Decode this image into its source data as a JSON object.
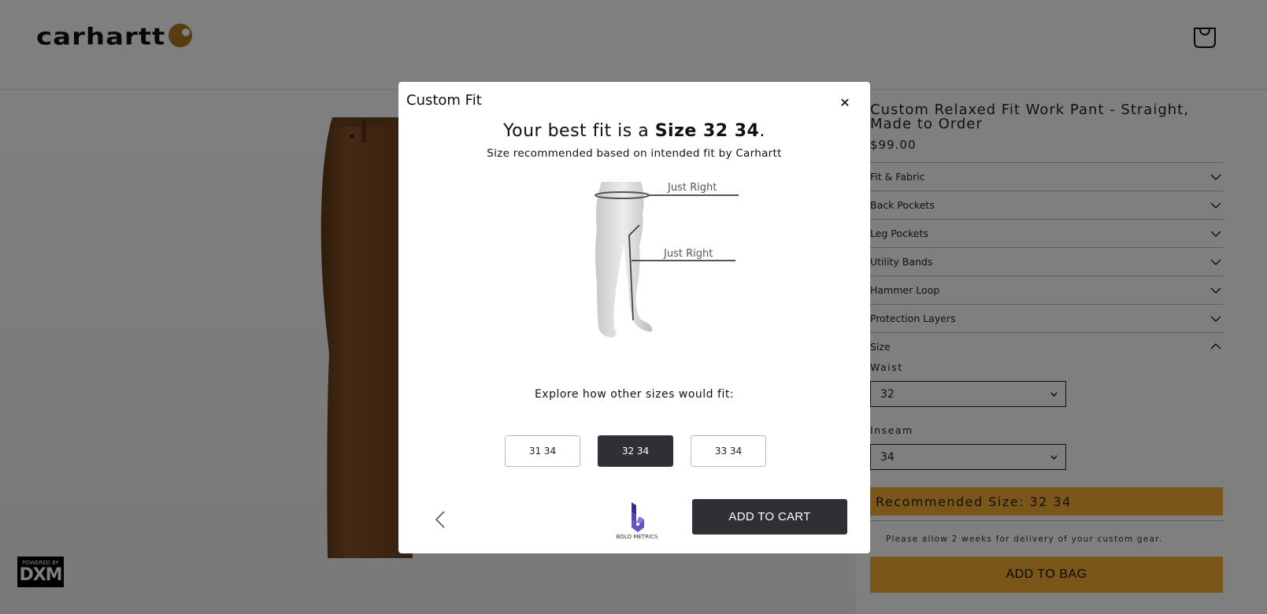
{
  "header": {
    "logo_text": "carhartt",
    "cart_icon": "shopping-bag-icon"
  },
  "product": {
    "title": "Custom Relaxed Fit Work Pant - Straight, Made to Order",
    "price": "$99.00",
    "accordion": [
      {
        "label": "Fit & Fabric",
        "icon": "chevron-down-icon"
      },
      {
        "label": "Back Pockets",
        "icon": "chevron-down-icon"
      },
      {
        "label": "Leg Pockets",
        "icon": "chevron-down-icon"
      },
      {
        "label": "Utility Bands",
        "icon": "chevron-down-icon"
      },
      {
        "label": "Hammer Loop",
        "icon": "chevron-down-icon"
      },
      {
        "label": "Protection Layers",
        "icon": "chevron-down-icon"
      }
    ],
    "size": {
      "label": "Size",
      "icon": "chevron-up-icon",
      "waist_label": "Waist",
      "waist_value": "32",
      "inseam_label": "Inseam",
      "inseam_value": "34"
    },
    "recommended": "Recommended Size: 32 34",
    "delivery_note": "Please allow 2 weeks for delivery of your custom gear.",
    "add_to_bag": "ADD TO BAG",
    "powered_by": "POWERED BY",
    "powered_brand": "DXM"
  },
  "colors": {
    "accent": "#f4ad30",
    "dark_button": "#2f3035",
    "pants": "#7a4a22"
  },
  "modal": {
    "title": "Custom Fit",
    "close_icon": "close-icon",
    "headline_prefix": "Your best fit is a ",
    "headline_size": "Size 32 34",
    "headline_suffix": ".",
    "subtitle": "Size recommended based on intended fit by Carhartt",
    "waist_fit": "Just Right",
    "inseam_fit": "Just Right",
    "explore": "Explore how other sizes would fit:",
    "sizes": [
      {
        "label": "31 34",
        "selected": false
      },
      {
        "label": "32 34",
        "selected": true
      },
      {
        "label": "33 34",
        "selected": false
      }
    ],
    "back_icon": "chevron-left-icon",
    "partner_logo": "BOLD METRICS",
    "add_to_cart": "ADD TO CART"
  }
}
